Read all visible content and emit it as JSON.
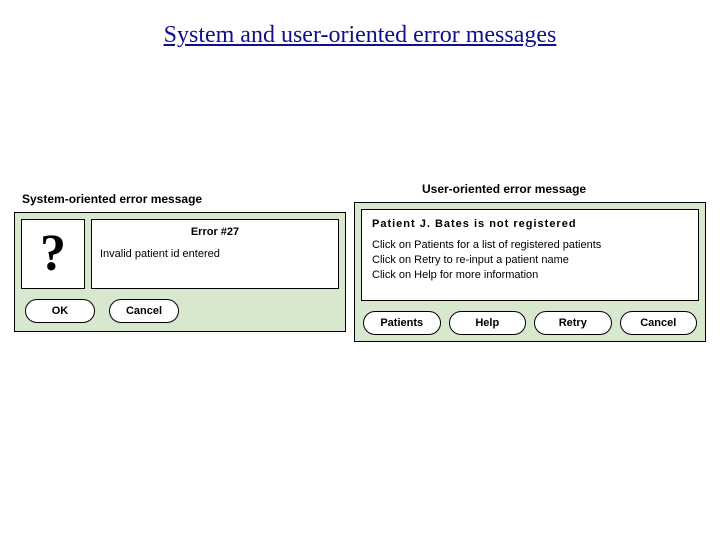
{
  "title": "System and user-oriented error messages",
  "system": {
    "caption": "System-oriented error message",
    "icon_char": "?",
    "error_title": "Error #27",
    "error_body": "Invalid patient id entered",
    "buttons": {
      "ok": "OK",
      "cancel": "Cancel"
    }
  },
  "user": {
    "caption": "User-oriented error message",
    "heading": "Patient  J. Bates  is  not  registered",
    "lines": {
      "l1": "Click on Patients for a list of registered patients",
      "l2": "Click on Retry to re-input a patient name",
      "l3": "Click on Help for more information"
    },
    "buttons": {
      "patients": "Patients",
      "help": "Help",
      "retry": "Retry",
      "cancel": "Cancel"
    }
  }
}
